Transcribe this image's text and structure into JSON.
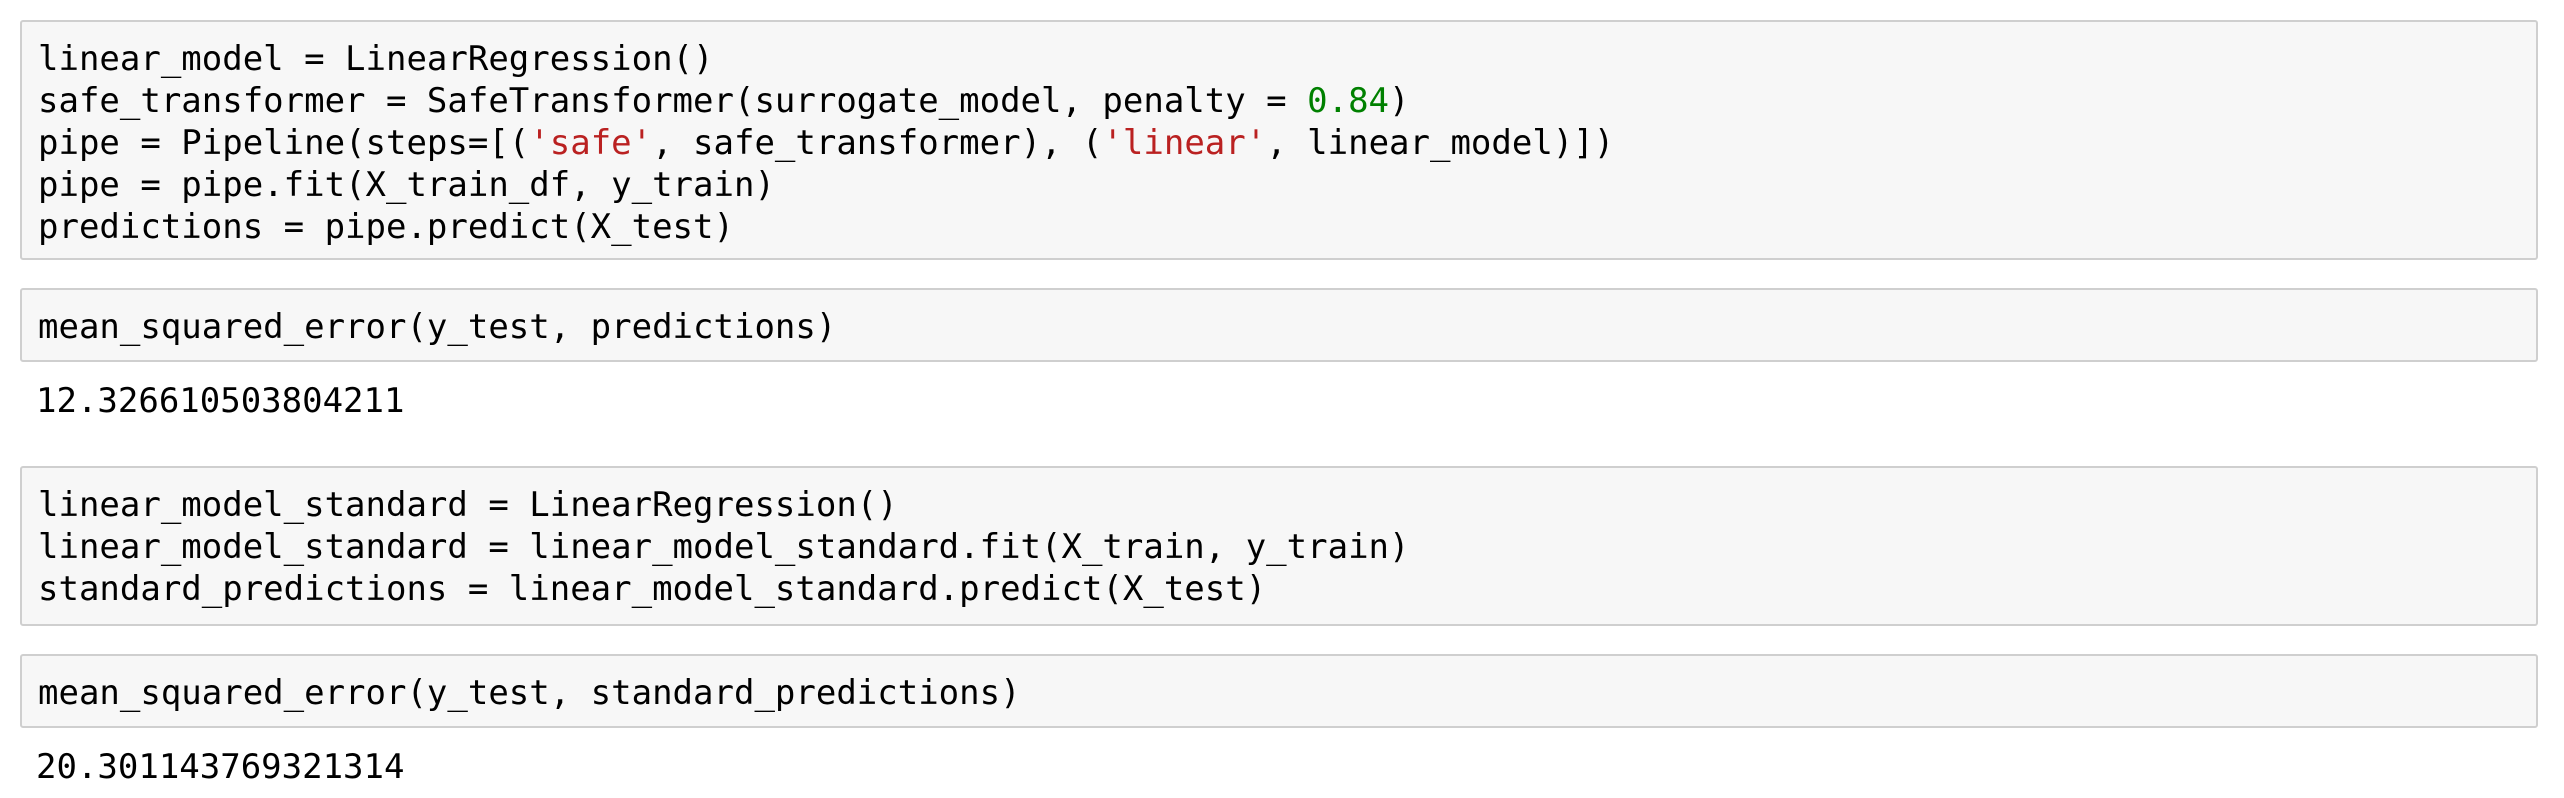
{
  "cells": [
    {
      "id": "cell-1",
      "lines": [
        {
          "parts": [
            {
              "t": "linear_model = LinearRegression()"
            }
          ]
        },
        {
          "parts": [
            {
              "t": "safe_transformer = SafeTransformer(surrogate_model, penalty = "
            },
            {
              "t": "0.84",
              "k": "num"
            },
            {
              "t": ")"
            }
          ]
        },
        {
          "parts": [
            {
              "t": "pipe = Pipeline(steps=[("
            },
            {
              "t": "'safe'",
              "k": "str"
            },
            {
              "t": ", safe_transformer), ("
            },
            {
              "t": "'linear'",
              "k": "str"
            },
            {
              "t": ", linear_model)])"
            }
          ]
        },
        {
          "parts": [
            {
              "t": "pipe = pipe.fit(X_train_df, y_train)"
            }
          ]
        },
        {
          "parts": [
            {
              "t": "predictions = pipe.predict(X_test)"
            }
          ]
        }
      ]
    },
    {
      "id": "cell-2",
      "lines": [
        {
          "parts": [
            {
              "t": "mean_squared_error(y_test, predictions)"
            }
          ]
        }
      ],
      "output": "12.326610503804211"
    },
    {
      "id": "cell-3",
      "lines": [
        {
          "parts": [
            {
              "t": "linear_model_standard = LinearRegression()"
            }
          ]
        },
        {
          "parts": [
            {
              "t": "linear_model_standard = linear_model_standard.fit(X_train, y_train)"
            }
          ]
        },
        {
          "parts": [
            {
              "t": "standard_predictions = linear_model_standard.predict(X_test)"
            }
          ]
        }
      ]
    },
    {
      "id": "cell-4",
      "lines": [
        {
          "parts": [
            {
              "t": "mean_squared_error(y_test, standard_predictions)"
            }
          ]
        }
      ],
      "output": "20.301143769321314"
    }
  ],
  "colors": {
    "number": "#008000",
    "string": "#ba2121",
    "cell_background": "#f7f7f7",
    "cell_border": "#cfcfcf"
  }
}
